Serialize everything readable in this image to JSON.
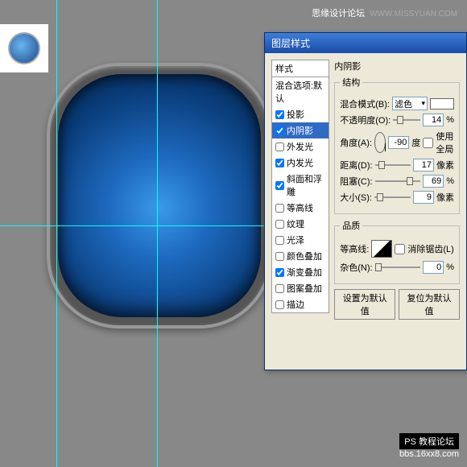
{
  "watermark": {
    "top1": "思缘设计论坛",
    "top2": "WWW.MISSYUAN.COM",
    "bottom1": "PS 教程论坛",
    "bottom2": "bbs.16xx8.com"
  },
  "dialog": {
    "title": "图层样式",
    "styles_header": "样式",
    "styles": [
      {
        "label": "混合选项:默认",
        "checked": false,
        "checkbox": false
      },
      {
        "label": "投影",
        "checked": true,
        "checkbox": true
      },
      {
        "label": "内阴影",
        "checked": true,
        "checkbox": true,
        "selected": true
      },
      {
        "label": "外发光",
        "checked": false,
        "checkbox": true
      },
      {
        "label": "内发光",
        "checked": true,
        "checkbox": true
      },
      {
        "label": "斜面和浮雕",
        "checked": true,
        "checkbox": true
      },
      {
        "label": "等高线",
        "checked": false,
        "checkbox": true
      },
      {
        "label": "纹理",
        "checked": false,
        "checkbox": true
      },
      {
        "label": "光泽",
        "checked": false,
        "checkbox": true
      },
      {
        "label": "颜色叠加",
        "checked": false,
        "checkbox": true
      },
      {
        "label": "渐变叠加",
        "checked": true,
        "checkbox": true
      },
      {
        "label": "图案叠加",
        "checked": false,
        "checkbox": true
      },
      {
        "label": "描边",
        "checked": false,
        "checkbox": true
      }
    ],
    "panel_title": "内阴影",
    "group1": "结构",
    "blend_label": "混合模式(B):",
    "blend_value": "滤色",
    "opacity_label": "不透明度(O):",
    "opacity_value": "14",
    "opacity_unit": "%",
    "angle_label": "角度(A):",
    "angle_value": "-90",
    "angle_unit": "度",
    "global_label": "使用全局",
    "distance_label": "距离(D):",
    "distance_value": "17",
    "distance_unit": "像素",
    "choke_label": "阻塞(C):",
    "choke_value": "69",
    "choke_unit": "%",
    "size_label": "大小(S):",
    "size_value": "9",
    "size_unit": "像素",
    "group2": "品质",
    "contour_label": "等高线:",
    "antialias_label": "消除锯齿(L)",
    "noise_label": "杂色(N):",
    "noise_value": "0",
    "noise_unit": "%",
    "btn_default": "设置为默认值",
    "btn_reset": "复位为默认值"
  }
}
